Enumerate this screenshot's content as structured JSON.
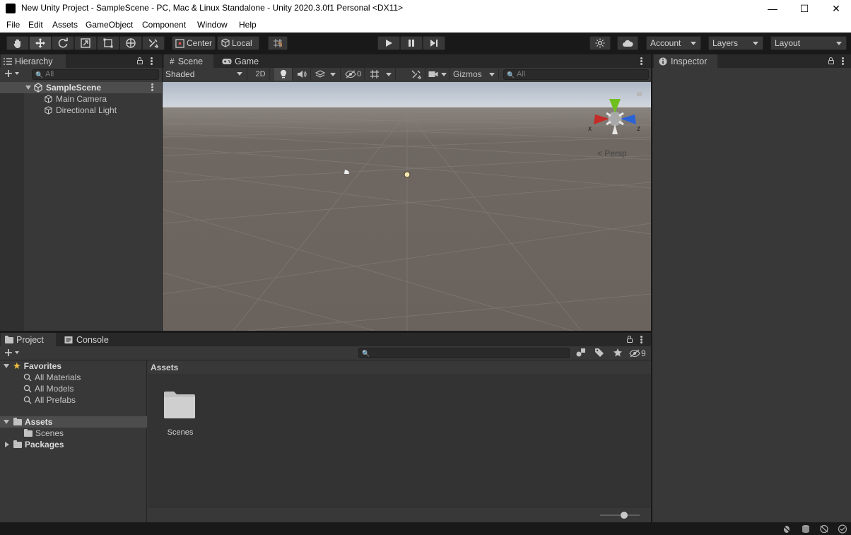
{
  "window": {
    "title": "New Unity Project - SampleScene - PC, Mac & Linux Standalone - Unity 2020.3.0f1 Personal <DX11>",
    "min_glyph": "—",
    "max_glyph": "☐",
    "close_glyph": "✕"
  },
  "menu": [
    "File",
    "Edit",
    "Assets",
    "GameObject",
    "Component",
    "Window",
    "Help"
  ],
  "toolbar": {
    "pivot_label": "Center",
    "space_label": "Local",
    "account_label": "Account",
    "layers_label": "Layers",
    "layout_label": "Layout"
  },
  "hierarchy": {
    "tab_label": "Hierarchy",
    "search_placeholder": "All",
    "scene_name": "SampleScene",
    "objects": [
      "Main Camera",
      "Directional Light"
    ]
  },
  "scene_view": {
    "tabs": [
      "Scene",
      "Game"
    ],
    "shading_mode": "Shaded",
    "mode_2d": "2D",
    "hidden_count": "0",
    "gizmos_label": "Gizmos",
    "search_placeholder": "All",
    "projection_label": "< Persp",
    "axis_x": "x",
    "axis_z": "z"
  },
  "inspector": {
    "tab_label": "Inspector"
  },
  "project": {
    "tabs": [
      "Project",
      "Console"
    ],
    "hidden_count": "9",
    "favorites_label": "Favorites",
    "favorites": [
      "All Materials",
      "All Models",
      "All Prefabs"
    ],
    "assets_label": "Assets",
    "asset_folders": [
      "Scenes"
    ],
    "packages_label": "Packages",
    "breadcrumb": "Assets",
    "grid_items": [
      "Scenes"
    ],
    "zoom_fraction": 0.6
  },
  "colors": {
    "selection": "#4d4d4d",
    "panel": "#383838",
    "tabbar": "#282828",
    "scene_ground": "#6e6660",
    "scene_sky": "#c8cfd9",
    "gizmo_green": "#6fc01f",
    "gizmo_red": "#c32c27",
    "gizmo_blue": "#2b62d6"
  }
}
